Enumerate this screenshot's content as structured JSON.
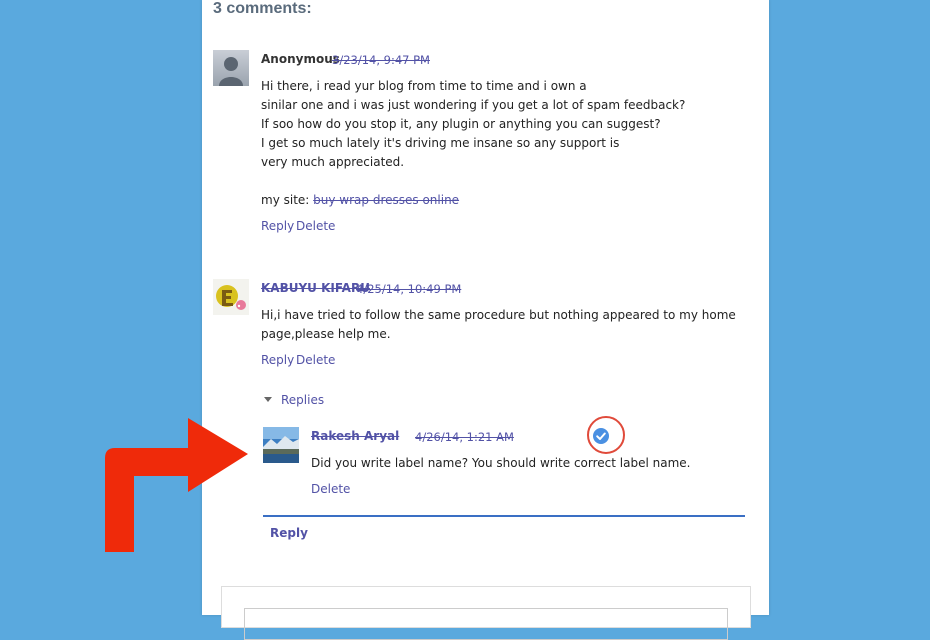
{
  "colors": {
    "background": "#5aa9de",
    "link": "#5252a6",
    "accent_line": "#3a6fc4",
    "annotation": "#ef2a0a"
  },
  "heading": "3 comments:",
  "comments": [
    {
      "author": "Anonymous",
      "timestamp": "3/23/14, 9:47 PM",
      "avatar_icon": "default-user-icon",
      "lines": [
        "Hi there, i read yur blog from time to time and i own a",
        "sinilar one and i was just wondering if you get a lot of spam feedback?",
        "If soo how do you stop it, any plugin or anything you can suggest?",
        "I get so much lately it's driving me insane so any support is",
        "very much appreciated."
      ],
      "site_label": "my site:",
      "site_link": "buy wrap dresses online",
      "actions": {
        "reply": "Reply",
        "delete": "Delete"
      }
    },
    {
      "author": "KABUYU KIFARU",
      "timestamp": "4/25/14, 10:49 PM",
      "avatar_icon": "cartoon-avatar",
      "text": "Hi,i have tried to follow the same procedure but nothing appeared to my home page,please help me.",
      "actions": {
        "reply": "Reply",
        "delete": "Delete"
      },
      "replies_label": "Replies",
      "replies": [
        {
          "author": "Rakesh Aryal",
          "timestamp": "4/26/14, 1:21 AM",
          "avatar_icon": "landscape-photo-avatar",
          "verified_icon": "verified-check-icon",
          "text": "Did you write label name? You should write correct label name.",
          "actions": {
            "delete": "Delete"
          }
        }
      ],
      "reply_button": "Reply"
    }
  ]
}
